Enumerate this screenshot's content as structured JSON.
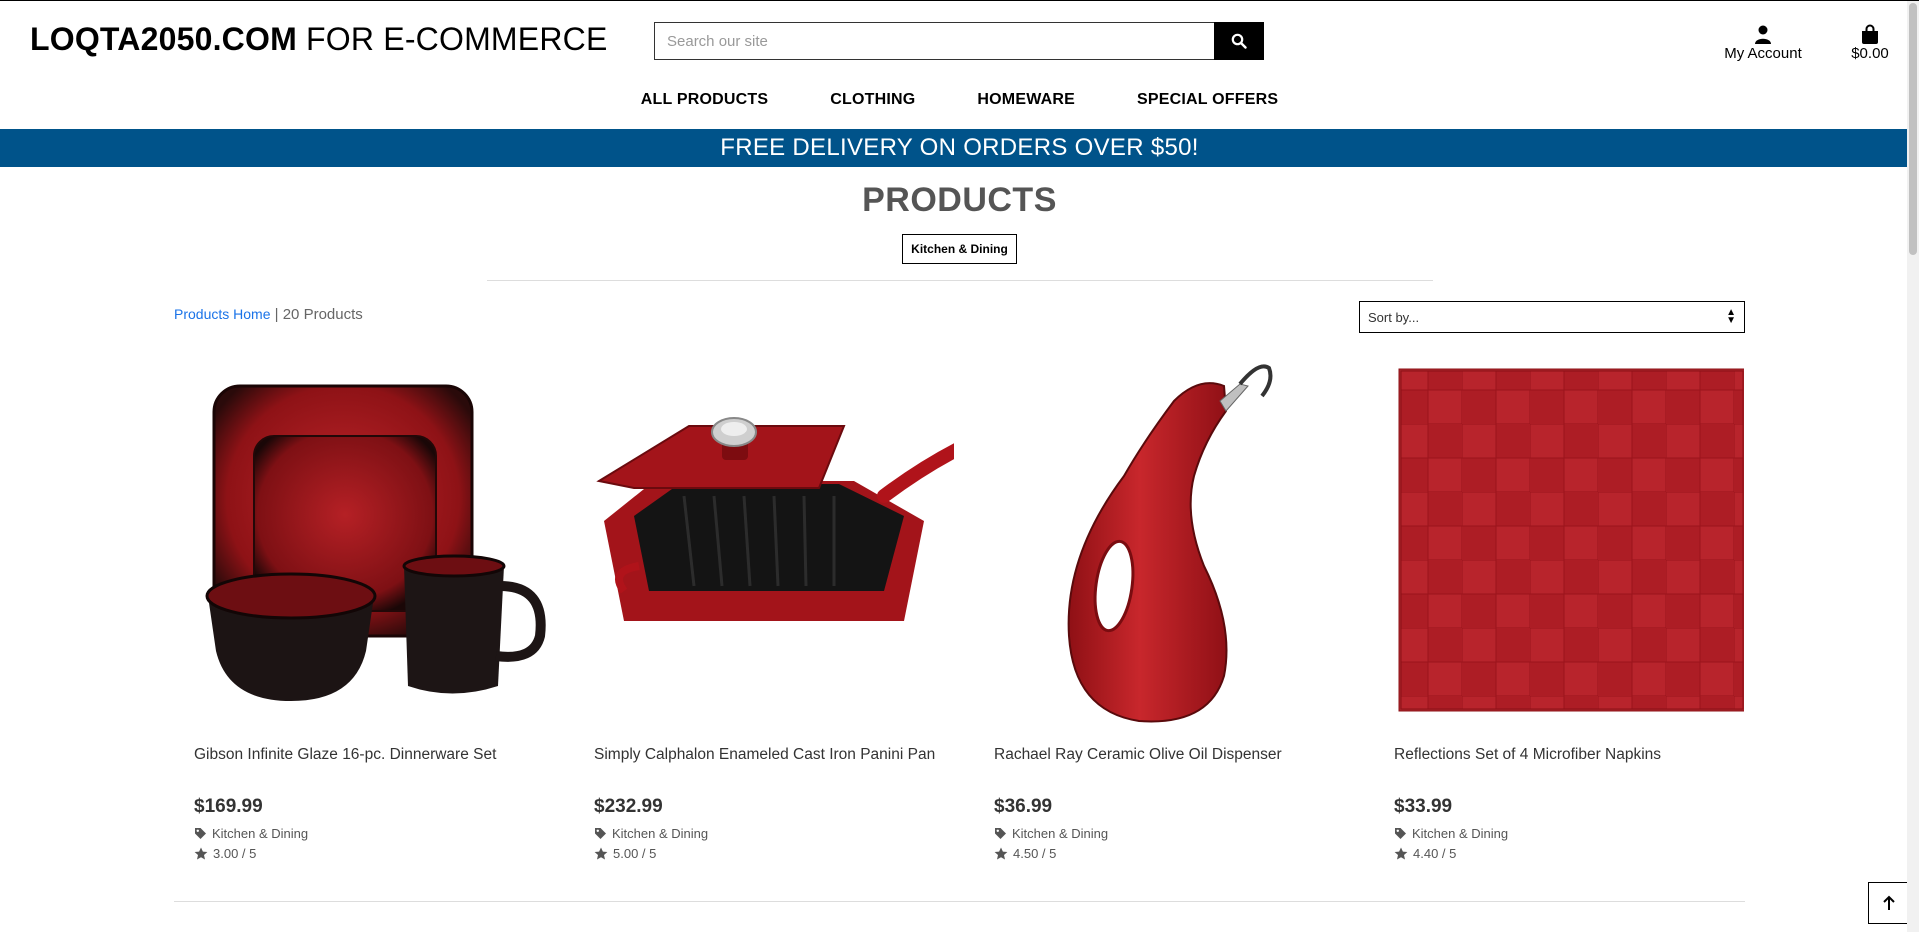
{
  "header": {
    "logo_bold": "LOQTA2050.COM",
    "logo_rest": " FOR E-COMMERCE",
    "search_placeholder": "Search our site",
    "account_label": "My Account",
    "cart_total": "$0.00"
  },
  "nav": {
    "items": [
      {
        "label": "ALL PRODUCTS"
      },
      {
        "label": "CLOTHING"
      },
      {
        "label": "HOMEWARE"
      },
      {
        "label": "SPECIAL OFFERS"
      }
    ]
  },
  "banner": {
    "text": "FREE DELIVERY ON ORDERS OVER $50!"
  },
  "main": {
    "title": "PRODUCTS",
    "category_badge": "Kitchen & Dining",
    "breadcrumb_link": "Products Home",
    "breadcrumb_sep": " | ",
    "product_count": "20 Products",
    "sort_label": "Sort by..."
  },
  "products": [
    {
      "name": "Gibson Infinite Glaze 16-pc. Dinnerware Set",
      "price": "$169.99",
      "category": "Kitchen & Dining",
      "rating": "3.00 / 5"
    },
    {
      "name": "Simply Calphalon Enameled Cast Iron Panini Pan",
      "price": "$232.99",
      "category": "Kitchen & Dining",
      "rating": "5.00 / 5"
    },
    {
      "name": "Rachael Ray Ceramic Olive Oil Dispenser",
      "price": "$36.99",
      "category": "Kitchen & Dining",
      "rating": "4.50 / 5"
    },
    {
      "name": "Reflections Set of 4 Microfiber Napkins",
      "price": "$33.99",
      "category": "Kitchen & Dining",
      "rating": "4.40 / 5"
    }
  ],
  "colors": {
    "banner_bg": "#00538a",
    "link": "#1a73e8",
    "product_red": "#b0131a"
  },
  "icons": [
    "search-icon",
    "user-icon",
    "shopping-bag-icon",
    "tag-icon",
    "star-icon",
    "arrow-up-icon"
  ]
}
